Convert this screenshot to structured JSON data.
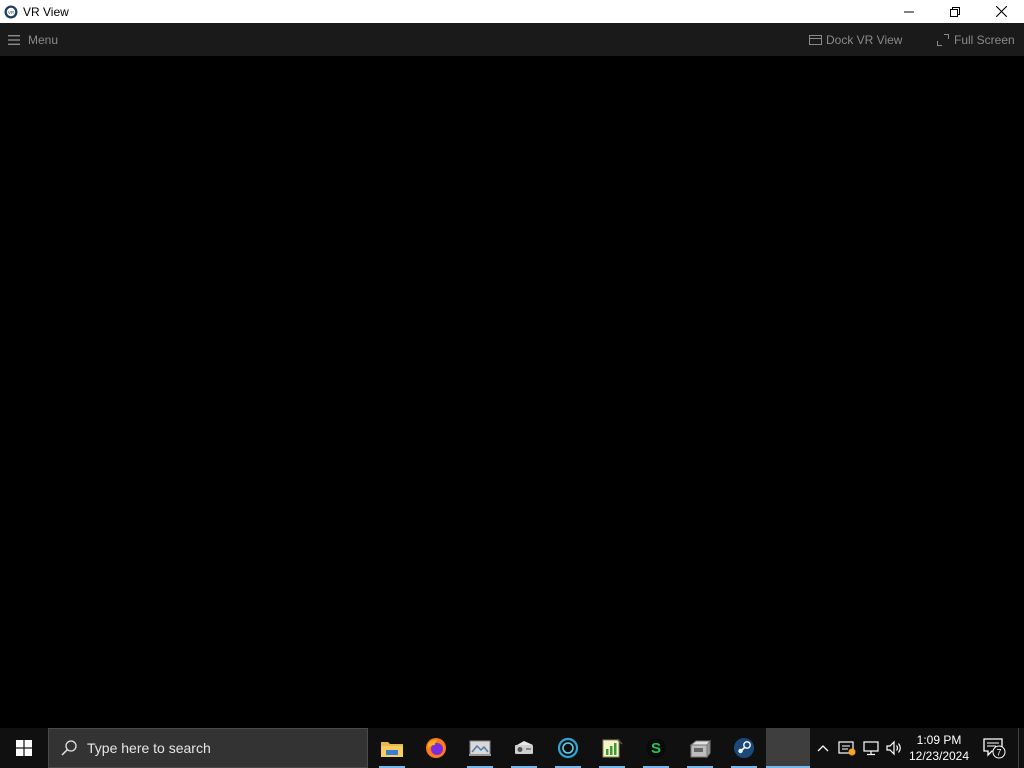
{
  "window": {
    "title": "VR View",
    "controls": [
      {
        "name": "minimize",
        "icon": "minimize-icon"
      },
      {
        "name": "restore",
        "icon": "restore-icon"
      },
      {
        "name": "close",
        "icon": "close-icon"
      }
    ]
  },
  "toolbar": {
    "menu_label": "Menu",
    "dock_label": "Dock VR View",
    "fullscreen_label": "Full Screen"
  },
  "taskbar": {
    "search_placeholder": "Type here to search",
    "apps": [
      {
        "name": "file-explorer",
        "icon": "folder-icon",
        "open": true,
        "active": false
      },
      {
        "name": "firefox",
        "icon": "firefox-icon",
        "open": false,
        "active": false
      },
      {
        "name": "photos-viewer",
        "icon": "photos-icon",
        "open": true,
        "active": false
      },
      {
        "name": "projector-app",
        "icon": "projector-icon",
        "open": true,
        "active": false
      },
      {
        "name": "ring-app",
        "icon": "ring-icon",
        "open": true,
        "active": false
      },
      {
        "name": "chart-notepad",
        "icon": "chart-document-icon",
        "open": true,
        "active": false
      },
      {
        "name": "green-s-app",
        "icon": "green-s-icon",
        "open": true,
        "active": false
      },
      {
        "name": "vr-headset-app",
        "icon": "headset-box-icon",
        "open": true,
        "active": false
      },
      {
        "name": "steam",
        "icon": "steam-icon",
        "open": true,
        "active": false
      },
      {
        "name": "vr-view-window",
        "icon": "blank-window-icon",
        "open": true,
        "active": true
      }
    ],
    "tray": {
      "icons": [
        "chevron-up-icon",
        "security-warning-icon",
        "network-icon",
        "volume-icon"
      ],
      "time": "1:09 PM",
      "date": "12/23/2024",
      "notification_count": "7"
    }
  },
  "colors": {
    "titlebar": "#ffffff",
    "toolbar": "#1a1a1a",
    "viewport": "#000000",
    "taskbar": "#101010",
    "search_box": "#333333",
    "indicator": "#76b9ed"
  }
}
